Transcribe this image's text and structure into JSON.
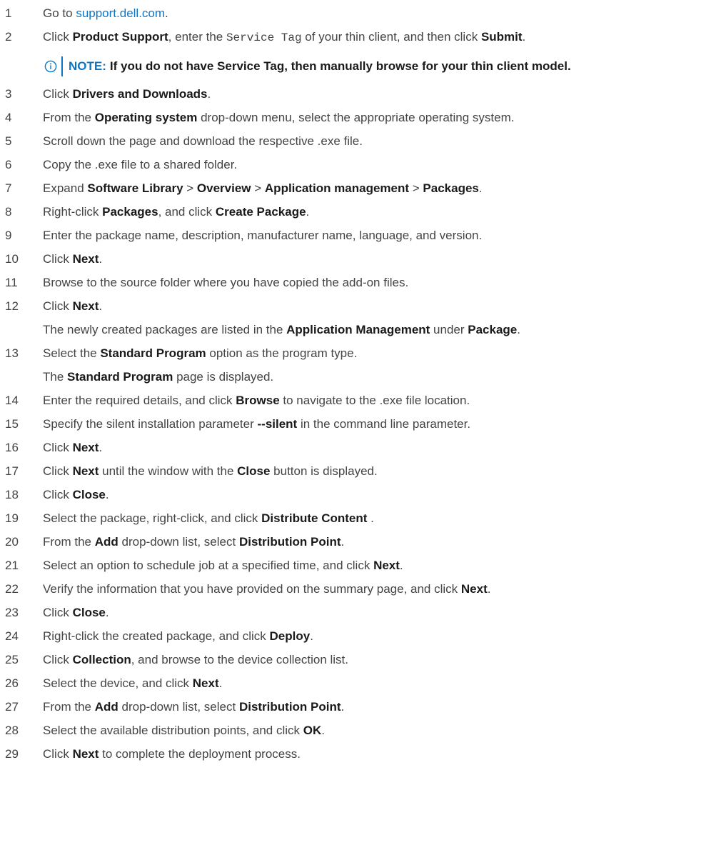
{
  "note": {
    "label": "NOTE:",
    "text": "If you do not have Service Tag, then manually browse for your thin client model.",
    "icon": "info-circle-icon",
    "color": "#0b76c5"
  },
  "steps": [
    {
      "num": "1",
      "parts": [
        {
          "t": "Go to "
        },
        {
          "t": "support.dell.com",
          "link": true
        },
        {
          "t": "."
        }
      ]
    },
    {
      "num": "2",
      "parts": [
        {
          "t": "Click "
        },
        {
          "t": "Product Support",
          "b": true
        },
        {
          "t": ", enter the "
        },
        {
          "t": "Service Tag",
          "code": true
        },
        {
          "t": " of your thin client, and then click "
        },
        {
          "t": "Submit",
          "b": true
        },
        {
          "t": "."
        }
      ]
    },
    {
      "num": "3",
      "parts": [
        {
          "t": "Click "
        },
        {
          "t": "Drivers and Downloads",
          "b": true
        },
        {
          "t": "."
        }
      ]
    },
    {
      "num": "4",
      "parts": [
        {
          "t": "From the "
        },
        {
          "t": "Operating system",
          "b": true
        },
        {
          "t": " drop-down menu, select the appropriate operating system."
        }
      ]
    },
    {
      "num": "5",
      "parts": [
        {
          "t": "Scroll down the page and download the respective .exe file."
        }
      ]
    },
    {
      "num": "6",
      "parts": [
        {
          "t": "Copy the .exe file to a shared folder."
        }
      ]
    },
    {
      "num": "7",
      "parts": [
        {
          "t": "Expand "
        },
        {
          "t": "Software Library",
          "b": true
        },
        {
          "t": " > "
        },
        {
          "t": "Overview",
          "b": true
        },
        {
          "t": " > "
        },
        {
          "t": "Application management",
          "b": true
        },
        {
          "t": " > "
        },
        {
          "t": "Packages",
          "b": true
        },
        {
          "t": "."
        }
      ]
    },
    {
      "num": "8",
      "parts": [
        {
          "t": "Right-click "
        },
        {
          "t": "Packages",
          "b": true
        },
        {
          "t": ", and click "
        },
        {
          "t": "Create Package",
          "b": true
        },
        {
          "t": "."
        }
      ]
    },
    {
      "num": "9",
      "parts": [
        {
          "t": "Enter the package name, description, manufacturer name, language, and version."
        }
      ]
    },
    {
      "num": "10",
      "parts": [
        {
          "t": "Click "
        },
        {
          "t": "Next",
          "b": true
        },
        {
          "t": "."
        }
      ]
    },
    {
      "num": "11",
      "parts": [
        {
          "t": "Browse to the source folder where you have copied the add-on files."
        }
      ]
    },
    {
      "num": "12",
      "parts": [
        {
          "t": "Click "
        },
        {
          "t": "Next",
          "b": true
        },
        {
          "t": "."
        }
      ],
      "extra": [
        {
          "t": "The newly created packages are listed in the "
        },
        {
          "t": "Application Management",
          "b": true
        },
        {
          "t": " under "
        },
        {
          "t": "Package",
          "b": true
        },
        {
          "t": "."
        }
      ]
    },
    {
      "num": "13",
      "parts": [
        {
          "t": "Select the "
        },
        {
          "t": "Standard Program",
          "b": true
        },
        {
          "t": " option as the program type."
        }
      ],
      "extra": [
        {
          "t": "The "
        },
        {
          "t": "Standard Program",
          "b": true
        },
        {
          "t": " page is displayed."
        }
      ]
    },
    {
      "num": "14",
      "parts": [
        {
          "t": "Enter the required details, and click "
        },
        {
          "t": "Browse",
          "b": true
        },
        {
          "t": " to navigate to the .exe file location."
        }
      ]
    },
    {
      "num": "15",
      "parts": [
        {
          "t": "Specify the silent installation parameter "
        },
        {
          "t": "--silent",
          "b": true
        },
        {
          "t": " in the command line parameter."
        }
      ]
    },
    {
      "num": "16",
      "parts": [
        {
          "t": "Click "
        },
        {
          "t": "Next",
          "b": true
        },
        {
          "t": "."
        }
      ]
    },
    {
      "num": "17",
      "parts": [
        {
          "t": "Click "
        },
        {
          "t": "Next",
          "b": true
        },
        {
          "t": " until the window with the "
        },
        {
          "t": "Close",
          "b": true
        },
        {
          "t": " button is displayed."
        }
      ]
    },
    {
      "num": "18",
      "parts": [
        {
          "t": "Click "
        },
        {
          "t": "Close",
          "b": true
        },
        {
          "t": "."
        }
      ]
    },
    {
      "num": "19",
      "parts": [
        {
          "t": "Select the package, right-click, and click "
        },
        {
          "t": "Distribute Content",
          "b": true
        },
        {
          "t": " ."
        }
      ]
    },
    {
      "num": "20",
      "parts": [
        {
          "t": "From the "
        },
        {
          "t": "Add",
          "b": true
        },
        {
          "t": " drop-down list, select "
        },
        {
          "t": "Distribution Point",
          "b": true
        },
        {
          "t": "."
        }
      ]
    },
    {
      "num": "21",
      "parts": [
        {
          "t": "Select an option to schedule job at a specified time, and click "
        },
        {
          "t": "Next",
          "b": true
        },
        {
          "t": "."
        }
      ]
    },
    {
      "num": "22",
      "parts": [
        {
          "t": "Verify the information that you have provided on the summary page, and click "
        },
        {
          "t": "Next",
          "b": true
        },
        {
          "t": "."
        }
      ]
    },
    {
      "num": "23",
      "parts": [
        {
          "t": "Click "
        },
        {
          "t": "Close",
          "b": true
        },
        {
          "t": "."
        }
      ]
    },
    {
      "num": "24",
      "parts": [
        {
          "t": "Right-click the created package, and click "
        },
        {
          "t": "Deploy",
          "b": true
        },
        {
          "t": "."
        }
      ]
    },
    {
      "num": "25",
      "parts": [
        {
          "t": "Click "
        },
        {
          "t": "Collection",
          "b": true
        },
        {
          "t": ", and browse to the device collection list."
        }
      ]
    },
    {
      "num": "26",
      "parts": [
        {
          "t": "Select the device, and click "
        },
        {
          "t": "Next",
          "b": true
        },
        {
          "t": "."
        }
      ]
    },
    {
      "num": "27",
      "parts": [
        {
          "t": "From the "
        },
        {
          "t": "Add",
          "b": true
        },
        {
          "t": " drop-down list, select "
        },
        {
          "t": "Distribution Point",
          "b": true
        },
        {
          "t": "."
        }
      ]
    },
    {
      "num": "28",
      "parts": [
        {
          "t": "Select the available distribution points, and click "
        },
        {
          "t": "OK",
          "b": true
        },
        {
          "t": "."
        }
      ]
    },
    {
      "num": "29",
      "parts": [
        {
          "t": "Click "
        },
        {
          "t": "Next",
          "b": true
        },
        {
          "t": " to complete the deployment process."
        }
      ]
    }
  ]
}
